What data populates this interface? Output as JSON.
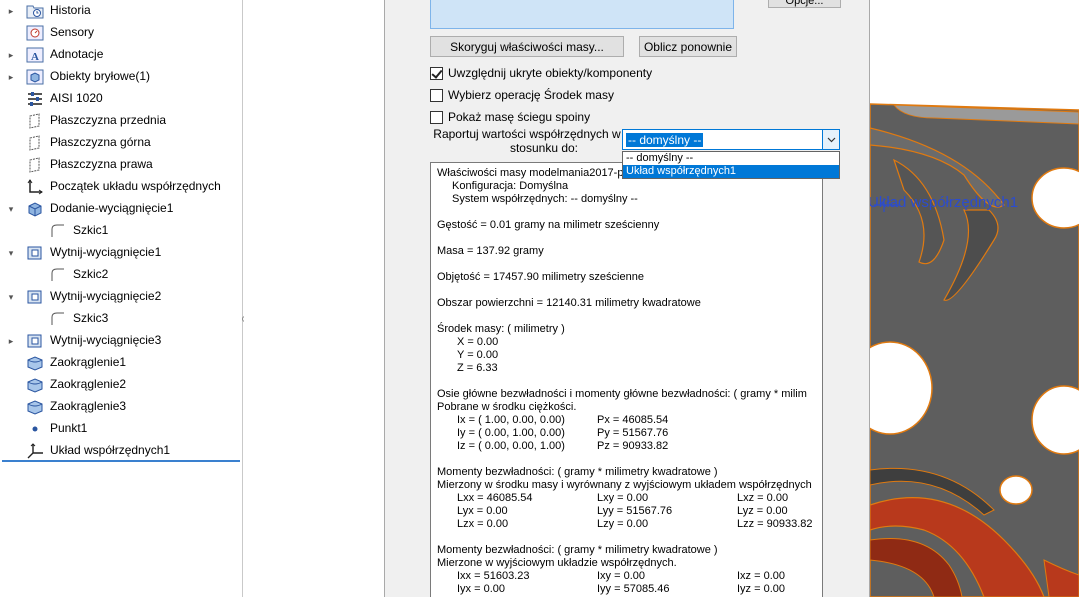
{
  "tree": {
    "items": [
      {
        "label": "Historia",
        "icon": "history-folder-icon",
        "expand": true
      },
      {
        "label": "Sensory",
        "icon": "sensor-icon",
        "expand": false
      },
      {
        "label": "Adnotacje",
        "icon": "annotation-icon",
        "expand": true
      },
      {
        "label": "Obiekty bryłowe(1)",
        "icon": "solid-bodies-icon",
        "expand": true
      },
      {
        "label": "AISI 1020",
        "icon": "material-icon",
        "expand": false
      },
      {
        "label": "Płaszczyzna przednia",
        "icon": "plane-icon",
        "expand": false
      },
      {
        "label": "Płaszczyzna górna",
        "icon": "plane-icon",
        "expand": false
      },
      {
        "label": "Płaszczyzna prawa",
        "icon": "plane-icon",
        "expand": false
      },
      {
        "label": "Początek układu współrzędnych",
        "icon": "origin-icon",
        "expand": false
      },
      {
        "label": "Dodanie-wyciągnięcie1",
        "icon": "extrude-boss-icon",
        "expand": true
      },
      {
        "label": "Szkic1",
        "icon": "sketch-icon",
        "expand": false
      },
      {
        "label": "Wytnij-wyciągnięcie1",
        "icon": "extrude-cut-icon",
        "expand": true
      },
      {
        "label": "Szkic2",
        "icon": "sketch-icon",
        "expand": false
      },
      {
        "label": "Wytnij-wyciągnięcie2",
        "icon": "extrude-cut-icon",
        "expand": true
      },
      {
        "label": "Szkic3",
        "icon": "sketch-icon",
        "expand": false
      },
      {
        "label": "Wytnij-wyciągnięcie3",
        "icon": "extrude-cut-icon",
        "expand": true
      },
      {
        "label": "Zaokrąglenie1",
        "icon": "fillet-icon",
        "expand": false
      },
      {
        "label": "Zaokrąglenie2",
        "icon": "fillet-icon",
        "expand": false
      },
      {
        "label": "Zaokrąglenie3",
        "icon": "fillet-icon",
        "expand": false
      },
      {
        "label": "Punkt1",
        "icon": "point-icon",
        "expand": false
      },
      {
        "label": "Układ współrzędnych1",
        "icon": "coordinate-system-icon",
        "expand": false
      }
    ]
  },
  "graphics": {
    "coord_label": "Układ współrzędnych1"
  },
  "dialog": {
    "options_label": "Opcje...",
    "override_button": "Skoryguj właściwości masy...",
    "recalc_button": "Oblicz ponownie",
    "checkboxes": [
      {
        "label": "Uwzględnij ukryte obiekty/komponenty",
        "checked": true
      },
      {
        "label": "Wybierz operację Środek masy",
        "checked": false
      },
      {
        "label": "Pokaż masę ściegu spoiny",
        "checked": false
      }
    ],
    "report_label_1": "Raportuj wartości współrzędnych w",
    "report_label_2": "stosunku do:",
    "combo_value": "-- domyślny --",
    "dropdown_options": [
      "-- domyślny --",
      "Układ współrzędnych1"
    ],
    "results": {
      "title": "Właściwości masy modelmania2017-p",
      "config": "Konfiguracja: Domyślna",
      "coordsys": "System współrzędnych: -- domyślny --",
      "density": "Gęstość = 0.01 gramy na milimetr sześcienny",
      "mass": "Masa = 137.92 gramy",
      "volume": "Objętość = 17457.90 milimetry sześcienne",
      "area": "Obszar powierzchni = 12140.31  milimetry kwadratowe",
      "com_title": "Środek masy: ( milimetry )",
      "com_x": "X = 0.00",
      "com_y": "Y = 0.00",
      "com_z": "Z = 6.33",
      "principal_title": "Osie główne bezwładności i momenty główne bezwładności: ( gramy *  milim",
      "principal_sub": "Pobrane w środku ciężkości.",
      "ix": "Ix = ( 1.00,  0.00,  0.00)",
      "iy": "Iy = ( 0.00,  1.00,  0.00)",
      "iz": "Iz = ( 0.00,  0.00,  1.00)",
      "px": "Px = 46085.54",
      "py": "Py = 51567.76",
      "pz": "Pz = 90933.82",
      "moments1_title": "Momenty bezwładności: ( gramy *  milimetry kwadratowe )",
      "moments1_sub": "Mierzony w środku masy i wyrównany z wyjściowym układem współrzędnych",
      "lxx": "Lxx = 46085.54",
      "lxy": "Lxy = 0.00",
      "lxz": "Lxz = 0.00",
      "lyx": "Lyx = 0.00",
      "lyy": "Lyy = 51567.76",
      "lyz": "Lyz = 0.00",
      "lzx": "Lzx = 0.00",
      "lzy": "Lzy = 0.00",
      "lzz": "Lzz = 90933.82",
      "moments2_title": "Momenty bezwładności: ( gramy *  milimetry kwadratowe )",
      "moments2_sub": "Mierzone w wyjściowym układzie współrzędnych.",
      "ixx": "Ixx = 51603.23",
      "ixy": "Ixy = 0.00",
      "ixz": "Ixz = 0.00",
      "iyx": "Iyx = 0.00",
      "iyy": "Iyy = 57085.46",
      "iyz": "Iyz = 0.00"
    }
  },
  "colors": {
    "selection_blue": "#0078d7",
    "model_face": "#5f5f5f",
    "model_edge": "#e07a10",
    "model_fillet": "#b8391c"
  }
}
